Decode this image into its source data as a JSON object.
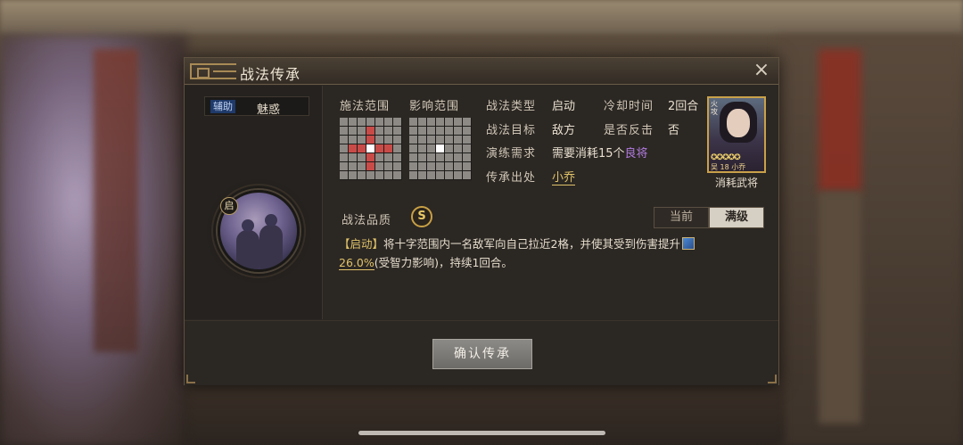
{
  "dialog": {
    "title": "战法传承",
    "close_icon": "close-icon"
  },
  "skill": {
    "type_tag": "辅助",
    "name": "魅惑",
    "badge": "启"
  },
  "ranges": {
    "cast_label": "施法范围",
    "effect_label": "影响范围"
  },
  "info": {
    "skill_type_label": "战法类型",
    "skill_type_value": "启动",
    "cooldown_label": "冷却时间",
    "cooldown_value": "2回合",
    "target_label": "战法目标",
    "target_value": "敌方",
    "counter_label": "是否反击",
    "counter_value": "否",
    "train_label": "演练需求",
    "train_prefix": "需要消耗15个",
    "train_highlight": "良将",
    "source_label": "传承出处",
    "source_value": "小乔"
  },
  "hero": {
    "corner_text": "火攻",
    "stars": "✪✪✪✪✪",
    "faction": "吴",
    "cost": "18",
    "name": "小乔",
    "caption": "消耗武将"
  },
  "quality": {
    "label": "战法品质",
    "grade": "S",
    "tab_current": "当前",
    "tab_max": "满级"
  },
  "description": {
    "keyword": "【启动】",
    "text_1": "将十字范围内一名敌军向自己拉近2格，并使其受到伤害提升",
    "value": "26.0%",
    "text_2": "(受智力影响)，持续1回合。"
  },
  "footer": {
    "confirm_label": "确认传承"
  }
}
